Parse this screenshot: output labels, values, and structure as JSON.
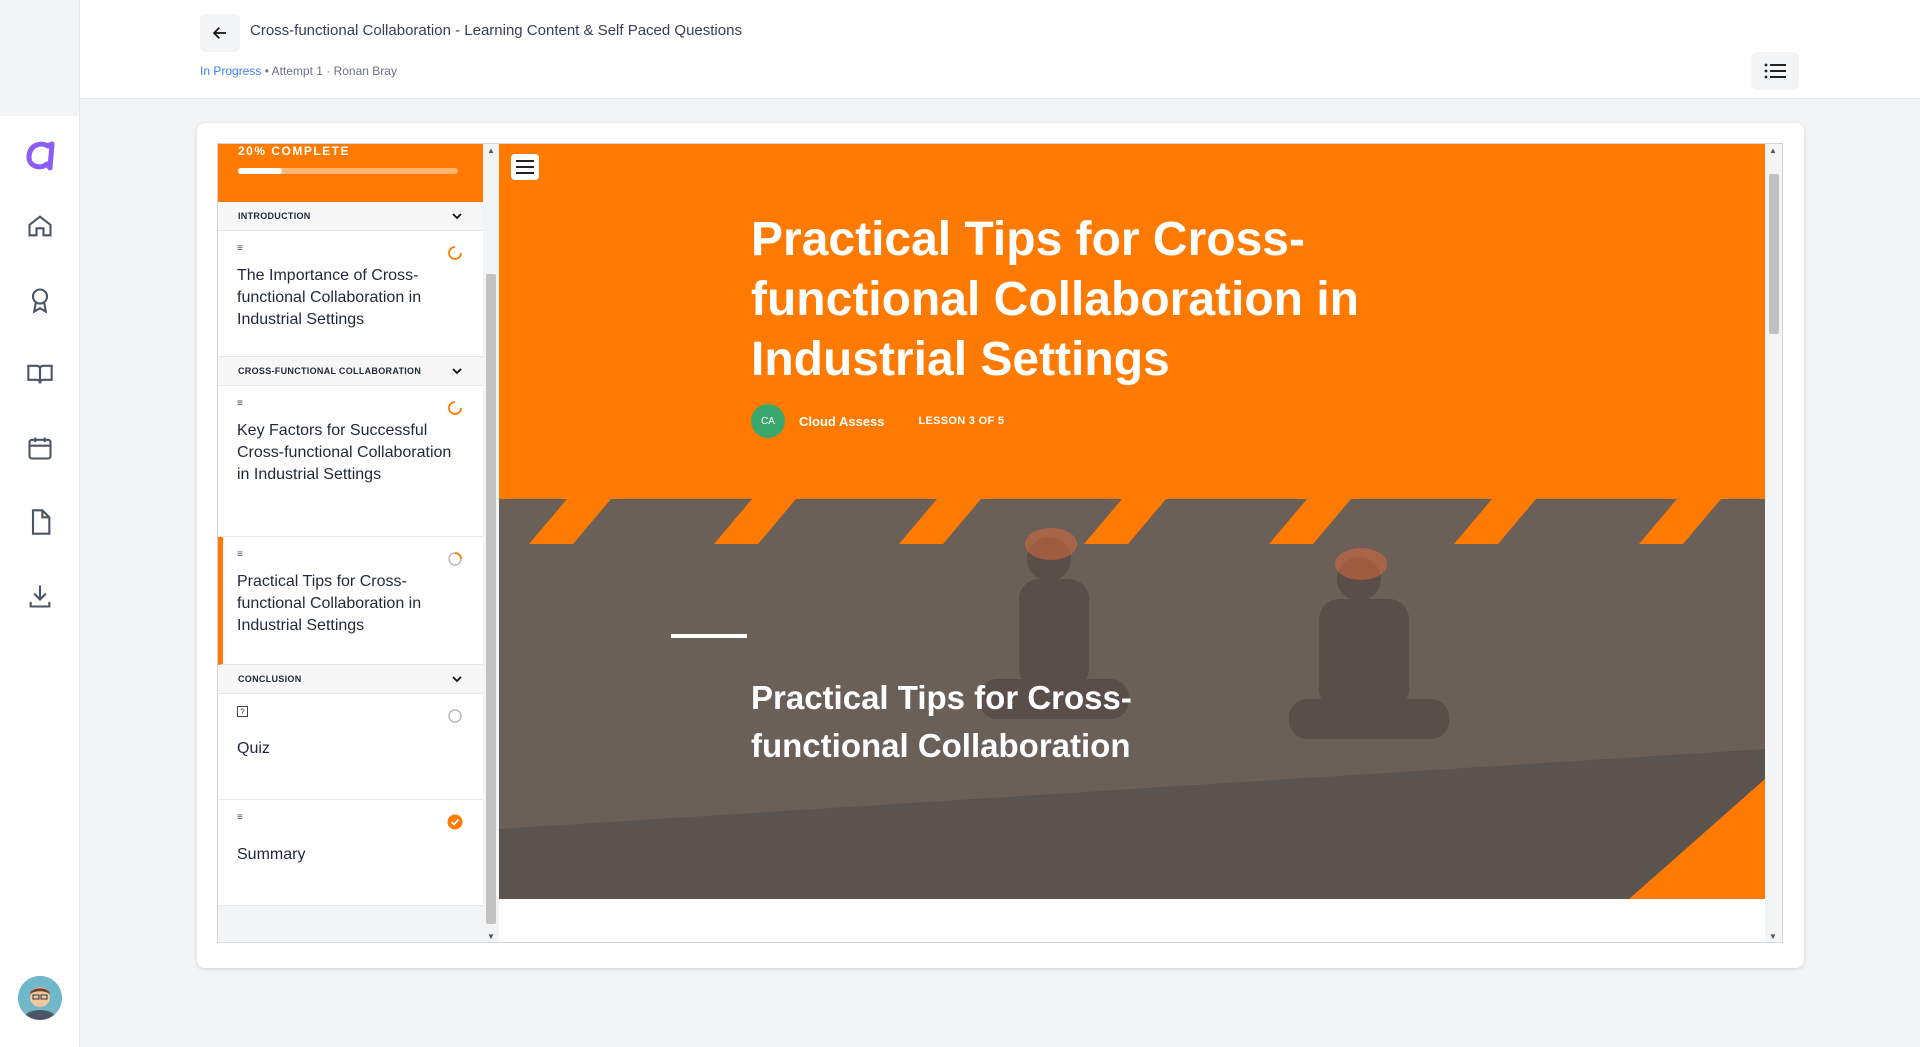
{
  "header": {
    "title": "Cross-functional Collaboration - Learning Content & Self Paced Questions",
    "status": "In Progress",
    "attempt": " • Attempt 1 · Ronan Bray"
  },
  "nav": {
    "items": [
      "home-icon",
      "award-icon",
      "book-icon",
      "calendar-icon",
      "document-icon",
      "download-icon"
    ]
  },
  "sidebar": {
    "progress_label": "20% COMPLETE",
    "progress_fraction": 0.2,
    "sections": [
      {
        "title": "INTRODUCTION",
        "items": [
          {
            "label": "The Importance of Cross-functional Collaboration in Industrial Settings",
            "status": "in-progress"
          }
        ]
      },
      {
        "title": "CROSS-FUNCTIONAL COLLABORATION",
        "items": [
          {
            "label": "Key Factors for Successful Cross-functional Collaboration in Industrial Settings",
            "status": "in-progress"
          },
          {
            "label": "Practical Tips for Cross-functional Collaboration in Industrial Settings",
            "status": "current"
          }
        ]
      },
      {
        "title": "CONCLUSION",
        "items": [
          {
            "label": "Quiz",
            "status": "not-started"
          },
          {
            "label": "Summary",
            "status": "complete"
          }
        ]
      }
    ]
  },
  "lesson": {
    "title": "Practical Tips for Cross-functional Collaboration in Industrial Settings",
    "author_initials": "CA",
    "author": "Cloud Assess",
    "lesson_number": "LESSON 3 OF 5",
    "banner_heading": "Practical Tips for Cross-functional Collaboration"
  },
  "colors": {
    "accent": "#ff7a00",
    "status_link": "#3b82f6",
    "author_avatar": "#3aa76d"
  }
}
